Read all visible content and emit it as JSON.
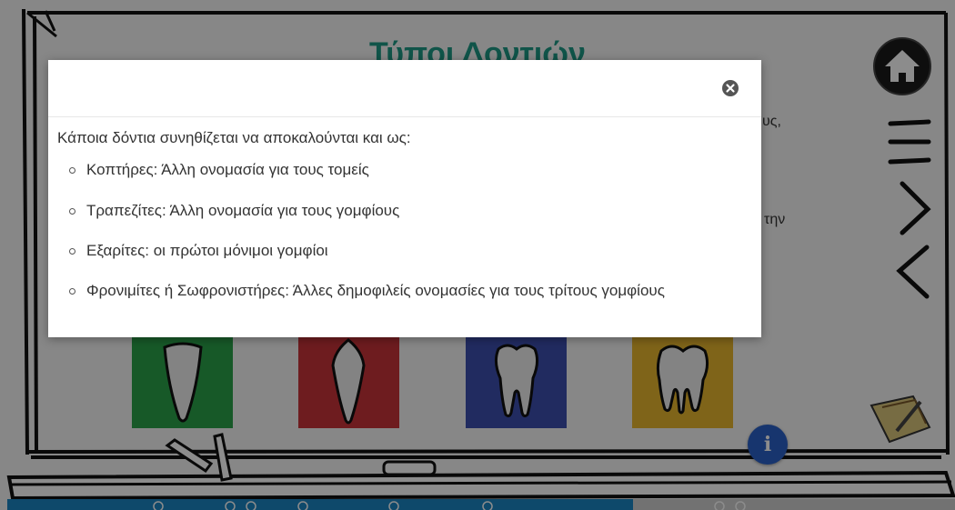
{
  "page": {
    "title": "Τύποι Δοντιών",
    "bg_text_1": "υς,",
    "bg_text_2": "την"
  },
  "nav": {
    "home_icon": "home-icon",
    "menu_icon": "hamburger-icon",
    "next_icon": "chevron-right-icon",
    "prev_icon": "chevron-left-icon",
    "info_label": "i"
  },
  "cards": [
    {
      "name": "incisor-card",
      "color": "#2aa24a",
      "icon": "incisor-tooth-icon"
    },
    {
      "name": "canine-card",
      "color": "#c9343a",
      "icon": "canine-tooth-icon"
    },
    {
      "name": "premolar-card",
      "color": "#3d4fb0",
      "icon": "premolar-tooth-icon"
    },
    {
      "name": "molar-card",
      "color": "#e7b72e",
      "icon": "molar-tooth-icon"
    }
  ],
  "modal": {
    "intro": "Κάποια δόντια συνηθίζεται να αποκαλούνται και ως:",
    "items": [
      "Κοπτήρες: Άλλη ονομασία για τους τομείς",
      "Τραπεζίτες: Άλλη ονομασία για τους γομφίους",
      "Εξαρίτες: οι πρώτοι μόνιμοι γομφίοι",
      "Φρονιμίτες ή Σωφρονιστήρες: Άλλες δημοφιλείς ονομασίες για τους τρίτους γομφίους"
    ],
    "close_icon": "close-icon"
  },
  "colors": {
    "title": "#1e9a86",
    "info": "#2a62c9",
    "progress": "#1a86c4"
  }
}
